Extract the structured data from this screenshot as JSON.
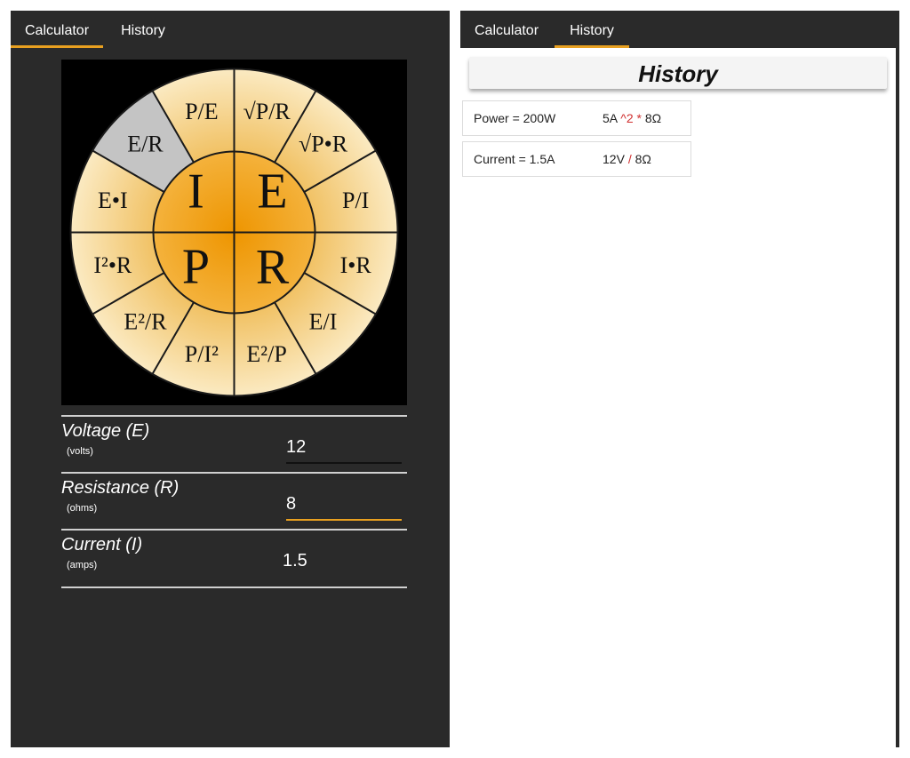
{
  "calculator_panel": {
    "tabs": [
      {
        "label": "Calculator",
        "active": true
      },
      {
        "label": "History",
        "active": false
      }
    ],
    "wheel": {
      "center": [
        "I",
        "E",
        "P",
        "R"
      ],
      "segments": [
        "P/E",
        "√P/R",
        "√P•R",
        "P/I",
        "I•R",
        "E/I",
        "E²/P",
        "P/I²",
        "E²/R",
        "I²•R",
        "E•I",
        "E/R"
      ],
      "selected_segment": "E/R",
      "colors": {
        "center": "#f0a010",
        "outer": "#f3d48e",
        "selected": "#c4c4c4",
        "lines": "#1a1a1a"
      }
    },
    "fields": [
      {
        "label": "Voltage (E)",
        "unit": "(volts)",
        "value": "12"
      },
      {
        "label": "Resistance (R)",
        "unit": "(ohms)",
        "value": "8",
        "focused": true
      },
      {
        "label": "Current (I)",
        "unit": "(amps)",
        "value": "1.5"
      }
    ]
  },
  "history_panel": {
    "tabs": [
      {
        "label": "Calculator",
        "active": false
      },
      {
        "label": "History",
        "active": true
      }
    ],
    "title": "History",
    "items": [
      {
        "result": "Power = 200W",
        "formula": {
          "a": "5A",
          "op1": "^2",
          "op2": "*",
          "b": "8Ω"
        }
      },
      {
        "result": "Current = 1.5A",
        "formula": {
          "a": "12V",
          "op1": "/",
          "b": "8Ω"
        }
      }
    ]
  },
  "colors": {
    "accent": "#e8a020",
    "dark_bg": "#2a2a2a",
    "operator": "#d03030"
  }
}
